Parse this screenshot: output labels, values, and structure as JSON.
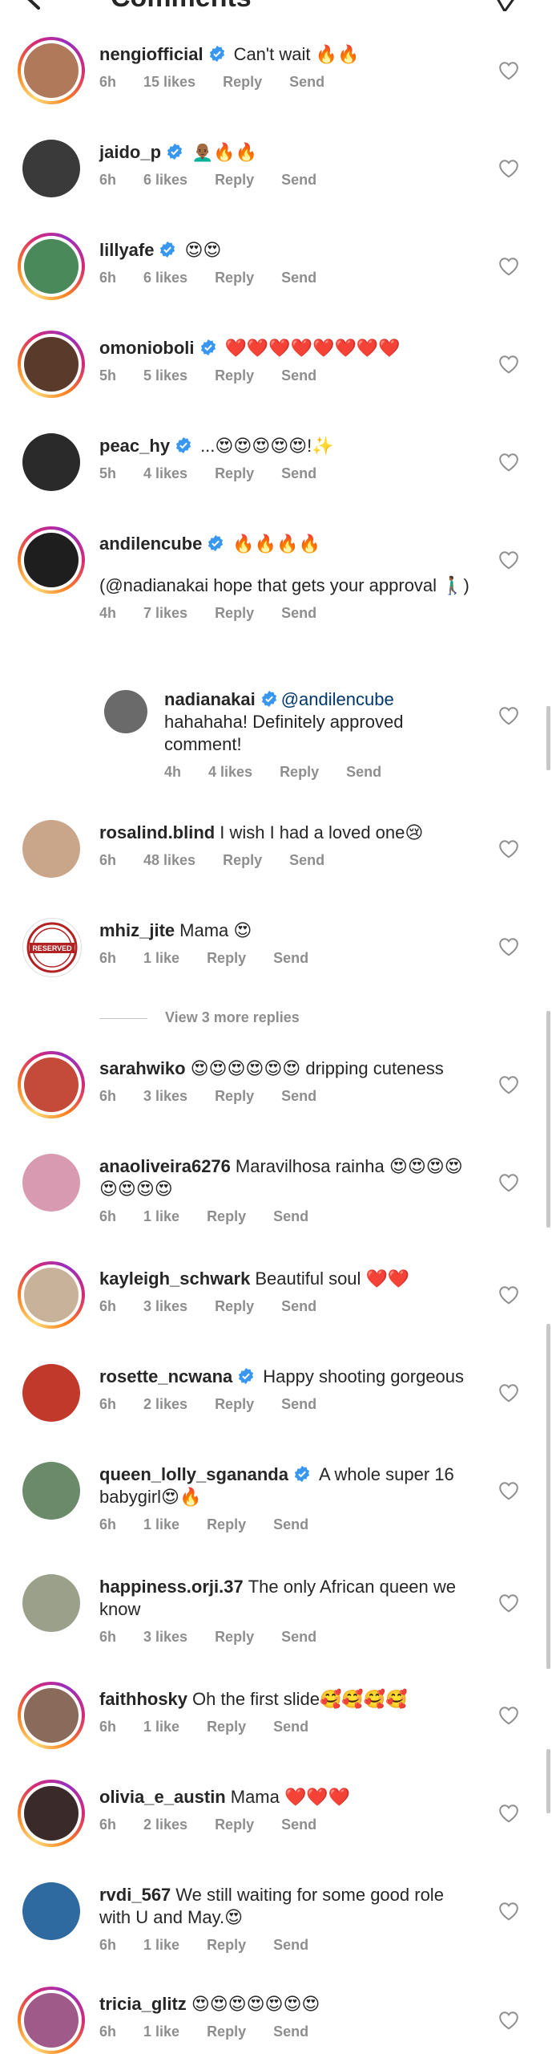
{
  "header": {
    "title": "Comments",
    "back_icon": "back-arrow-icon",
    "send_icon": "send-icon"
  },
  "labels": {
    "reply": "Reply",
    "send": "Send"
  },
  "comments": [
    {
      "username": "nengiofficial",
      "verified": true,
      "text": "Can't wait 🔥🔥",
      "time": "6h",
      "likes": "15 likes",
      "ring": true,
      "avatar_color": "#b07a5a"
    },
    {
      "username": "jaido_p",
      "verified": true,
      "text": "👨🏾‍🦲🔥🔥",
      "time": "6h",
      "likes": "6 likes",
      "ring": false,
      "avatar_color": "#3a3a3a"
    },
    {
      "username": "lillyafe",
      "verified": true,
      "text": "😍😍",
      "time": "6h",
      "likes": "6 likes",
      "ring": true,
      "avatar_color": "#4a8a5a"
    },
    {
      "username": "omonioboli",
      "verified": true,
      "text": "❤️❤️❤️❤️❤️❤️❤️❤️",
      "time": "5h",
      "likes": "5 likes",
      "ring": true,
      "avatar_color": "#5a3a2a"
    },
    {
      "username": "peac_hy",
      "verified": true,
      "text": "...😍😍😍😍😍!✨",
      "time": "5h",
      "likes": "4 likes",
      "ring": false,
      "avatar_color": "#2a2a2a"
    },
    {
      "username": "andilencube",
      "verified": true,
      "text": "🔥🔥🔥🔥",
      "text2": "(@nadianakai hope that gets your approval 🚶🏾‍♂️)",
      "time": "4h",
      "likes": "7 likes",
      "ring": true,
      "avatar_color": "#1e1e1e"
    },
    {
      "username": "nadianakai",
      "verified": true,
      "mention": "@andilencube",
      "text": "hahahaha! Definitely approved comment!",
      "time": "4h",
      "likes": "4 likes",
      "reply": true,
      "ring": false,
      "avatar_color": "#6a6a6a"
    },
    {
      "username": "rosalind.blind",
      "verified": false,
      "text": "I wish I had a loved one😢",
      "time": "6h",
      "likes": "48 likes",
      "ring": false,
      "avatar_color": "#c9a58a"
    },
    {
      "username": "mhiz_jite",
      "verified": false,
      "text": "Mama 😍",
      "time": "6h",
      "likes": "1 like",
      "ring": false,
      "avatar_color": "#ffffff",
      "reserved": true
    },
    {
      "username": "sarahwiko",
      "verified": false,
      "text": "😍😍😍😍😍😍 dripping cuteness",
      "time": "6h",
      "likes": "3 likes",
      "ring": true,
      "avatar_color": "#c44a3a"
    },
    {
      "username": "anaoliveira6276",
      "verified": false,
      "text": "Maravilhosa rainha 😍😍😍😍😍😍😍😍",
      "time": "6h",
      "likes": "1 like",
      "ring": false,
      "avatar_color": "#d89ab0"
    },
    {
      "username": "kayleigh_schwark",
      "verified": false,
      "text": "Beautiful soul ❤️❤️",
      "time": "6h",
      "likes": "3 likes",
      "ring": true,
      "avatar_color": "#c8b29a"
    },
    {
      "username": "rosette_ncwana",
      "verified": true,
      "text": "Happy shooting gorgeous",
      "time": "6h",
      "likes": "2 likes",
      "ring": false,
      "avatar_color": "#c0392b"
    },
    {
      "username": "queen_lolly_sgananda",
      "verified": true,
      "text": "A whole super 16 babygirl😍🔥",
      "time": "6h",
      "likes": "1 like",
      "ring": false,
      "avatar_color": "#6a8a6a"
    },
    {
      "username": "happiness.orji.37",
      "verified": false,
      "text": "The only African queen we know",
      "time": "6h",
      "likes": "3 likes",
      "ring": false,
      "avatar_color": "#9aa08a"
    },
    {
      "username": "faithhosky",
      "verified": false,
      "text": "Oh the first slide🥰🥰🥰🥰",
      "time": "6h",
      "likes": "1 like",
      "ring": true,
      "avatar_color": "#8a6a5a"
    },
    {
      "username": "olivia_e_austin",
      "verified": false,
      "text": "Mama ❤️❤️❤️",
      "time": "6h",
      "likes": "2 likes",
      "ring": true,
      "avatar_color": "#3a2a2a"
    },
    {
      "username": "rvdi_567",
      "verified": false,
      "text": "We still waiting for some good role with U and May.😍",
      "time": "6h",
      "likes": "1 like",
      "ring": false,
      "avatar_color": "#2e6aa0"
    },
    {
      "username": "tricia_glitz",
      "verified": false,
      "text": "😍😍😍😍😍😍😍",
      "time": "6h",
      "likes": "1 like",
      "ring": true,
      "avatar_color": "#a05a8a"
    }
  ],
  "view_more": "View 3 more replies",
  "reserved_stamp": "RESERVED",
  "colors": {
    "verified": "#3897f0",
    "meta": "#8e8e8e",
    "text": "#262626"
  }
}
